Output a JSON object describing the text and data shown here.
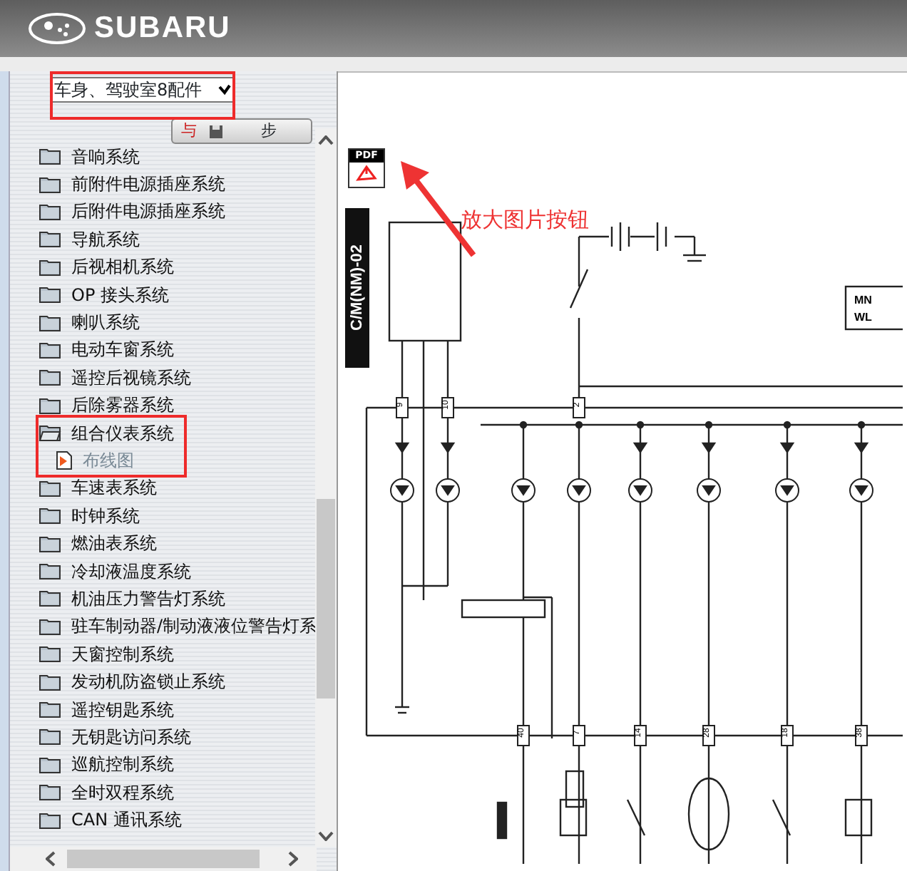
{
  "header": {
    "logo_text": "SUBARU"
  },
  "category_dropdown": {
    "value": "车身、驾驶室8配件"
  },
  "sync_toolbar": {
    "labels": [
      "与",
      "步"
    ]
  },
  "tree": [
    {
      "label": "音响系统",
      "expanded": false
    },
    {
      "label": "前附件电源插座系统",
      "expanded": false
    },
    {
      "label": "后附件电源插座系统",
      "expanded": false
    },
    {
      "label": "导航系统",
      "expanded": false
    },
    {
      "label": "后视相机系统",
      "expanded": false
    },
    {
      "label": "OP 接头系统",
      "expanded": false
    },
    {
      "label": "喇叭系统",
      "expanded": false
    },
    {
      "label": "电动车窗系统",
      "expanded": false
    },
    {
      "label": "遥控后视镜系统",
      "expanded": false
    },
    {
      "label": "后除雾器系统",
      "expanded": false
    },
    {
      "label": "组合仪表系统",
      "expanded": true,
      "children": [
        {
          "label": "布线图"
        }
      ]
    },
    {
      "label": "车速表系统",
      "expanded": false
    },
    {
      "label": "时钟系统",
      "expanded": false
    },
    {
      "label": "燃油表系统",
      "expanded": false
    },
    {
      "label": "冷却液温度系统",
      "expanded": false
    },
    {
      "label": "机油压力警告灯系统",
      "expanded": false
    },
    {
      "label": "驻车制动器/制动液液位警告灯系",
      "expanded": false
    },
    {
      "label": "天窗控制系统",
      "expanded": false
    },
    {
      "label": "发动机防盗锁止系统",
      "expanded": false
    },
    {
      "label": "遥控钥匙系统",
      "expanded": false
    },
    {
      "label": "无钥匙访问系统",
      "expanded": false
    },
    {
      "label": "巡航控制系统",
      "expanded": false
    },
    {
      "label": "全时双程系统",
      "expanded": false
    },
    {
      "label": "CAN 通讯系统",
      "expanded": false
    }
  ],
  "pdf_button": {
    "label": "PDF"
  },
  "annotation": {
    "text": "放大图片按钮"
  },
  "diagram": {
    "code": "C/M(NM)-02",
    "legend": [
      "MN",
      "WL"
    ],
    "top_terminals": [
      "9",
      "10",
      "2"
    ],
    "bottom_terminals": [
      "40",
      "7",
      "14",
      "28",
      "18",
      "38"
    ]
  }
}
